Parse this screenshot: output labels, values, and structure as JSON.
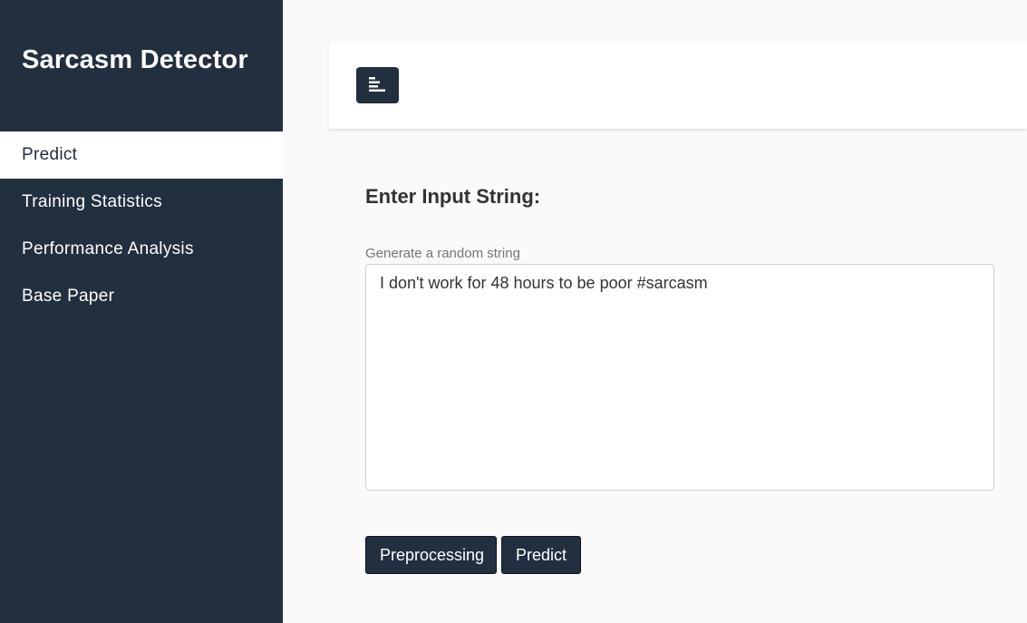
{
  "app": {
    "title": "Sarcasm Detector"
  },
  "sidebar": {
    "items": [
      {
        "label": "Predict",
        "active": true
      },
      {
        "label": "Training Statistics",
        "active": false
      },
      {
        "label": "Performance Analysis",
        "active": false
      },
      {
        "label": "Base Paper",
        "active": false
      }
    ]
  },
  "topbar": {
    "toggle_icon": "align-left-icon"
  },
  "main": {
    "heading": "Enter Input String:",
    "random_label": "Generate a random string",
    "input_value": "I don't work for 48 hours to be poor #sarcasm",
    "buttons": {
      "preprocessing": "Preprocessing",
      "predict": "Predict"
    }
  },
  "colors": {
    "sidebar_bg": "#212f3f",
    "page_bg": "#fafafa",
    "button_bg": "#212f3f",
    "active_item_bg": "#ffffff"
  }
}
